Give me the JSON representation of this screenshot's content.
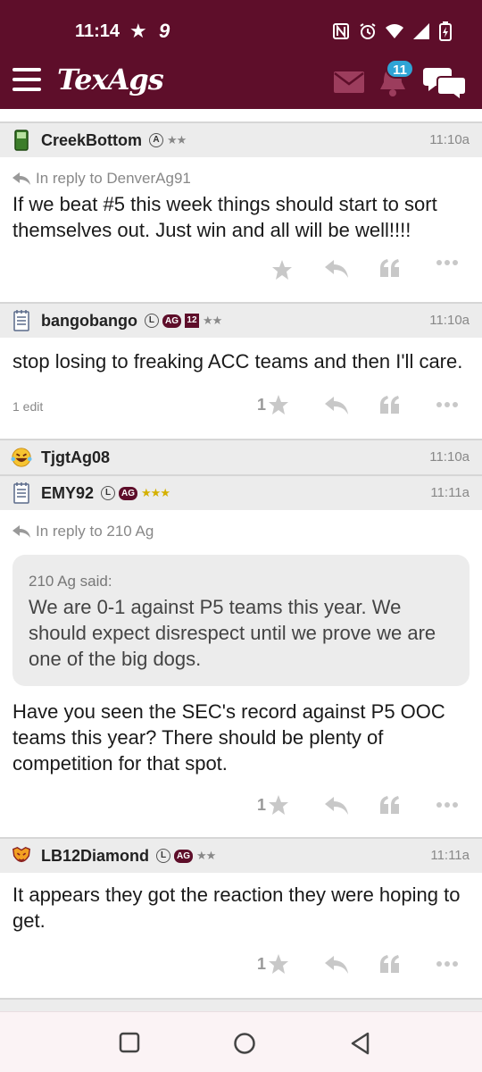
{
  "status_bar": {
    "time": "11:14",
    "indicator": "9",
    "icons": [
      "star-icon",
      "nfc-icon",
      "alarm-icon",
      "wifi-icon",
      "signal-icon",
      "battery-icon"
    ]
  },
  "app_bar": {
    "logo": "TexAgs",
    "notification_count": "11",
    "icons": [
      "menu-icon",
      "mail-icon",
      "bell-icon",
      "chat-icon"
    ]
  },
  "posts": [
    {
      "username": "CreekBottom",
      "badges": [
        "A"
      ],
      "stars": "★★",
      "time": "11:10a",
      "reply_to": "In reply to DenverAg91",
      "body": "If we beat #5 this week things should start to sort themselves out. Just win and all will be well!!!!"
    },
    {
      "username": "bangobango",
      "badges": [
        "L",
        "AG",
        "12"
      ],
      "stars": "★★",
      "time": "11:10a",
      "body": "stop losing to freaking ACC teams and then I'll care.",
      "edit_note": "1 edit",
      "star_count": "1"
    },
    {
      "username": "TjgtAg08",
      "time": "11:10a"
    },
    {
      "username": "EMY92",
      "badges": [
        "L",
        "AG"
      ],
      "stars": "★★★",
      "time": "11:11a",
      "reply_to": "In reply to 210 Ag",
      "quote_author": "210 Ag said:",
      "quote_text": "We are 0-1 against P5 teams this year. We should expect disrespect until we prove we are one of the big dogs.",
      "body": "Have you seen the SEC's record against P5 OOC teams this year? There should be plenty of competition for that spot.",
      "star_count": "1"
    },
    {
      "username": "LB12Diamond",
      "badges": [
        "L",
        "AG"
      ],
      "stars": "★★",
      "time": "11:11a",
      "body": "It appears they got the reaction they were hoping to get.",
      "star_count": "1"
    }
  ],
  "colors": {
    "brand": "#5e0e2a",
    "badge_blue": "#2fa4d6",
    "header_gray": "#ececec",
    "icon_gray": "#b5b5b5",
    "gold_star": "#d4b000"
  },
  "nav_bar": {
    "icons": [
      "recents-icon",
      "home-icon",
      "back-icon"
    ]
  }
}
